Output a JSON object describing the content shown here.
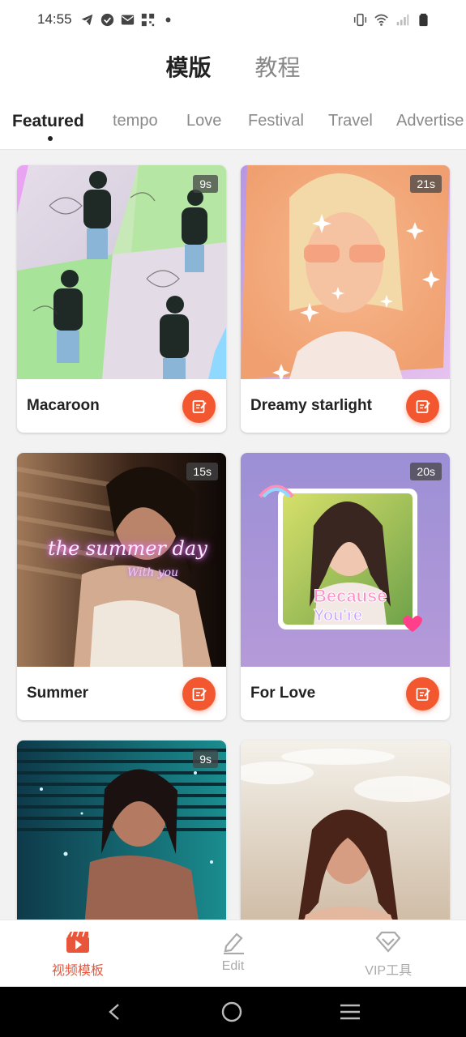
{
  "status_bar": {
    "time": "14:55",
    "left_icons": [
      "telegram-icon",
      "check-circle-icon",
      "mail-icon",
      "qr-icon",
      "dot-icon"
    ],
    "right_icons": [
      "vibrate-icon",
      "wifi-icon",
      "signal-icon",
      "battery-icon"
    ]
  },
  "top_tabs": [
    {
      "label": "模版",
      "active": true
    },
    {
      "label": "教程",
      "active": false
    }
  ],
  "category_tabs": [
    {
      "label": "Featured",
      "active": true
    },
    {
      "label": "tempo",
      "active": false
    },
    {
      "label": "Love",
      "active": false
    },
    {
      "label": "Festival",
      "active": false
    },
    {
      "label": "Travel",
      "active": false
    },
    {
      "label": "Advertise",
      "active": false
    }
  ],
  "cards": [
    {
      "title": "Macaroon",
      "duration": "9s"
    },
    {
      "title": "Dreamy starlight",
      "duration": "21s"
    },
    {
      "title": "Summer",
      "duration": "15s",
      "overlay_text": "the summer day",
      "overlay_sub": "With you"
    },
    {
      "title": "For Love",
      "duration": "20s",
      "overlay_text": "Because",
      "overlay_sub": "You're"
    },
    {
      "title": "",
      "duration": "9s"
    },
    {
      "title": "",
      "duration": ""
    }
  ],
  "bottom_nav": [
    {
      "label": "视频模板",
      "icon": "video-template-icon",
      "active": true
    },
    {
      "label": "Edit",
      "icon": "edit-pencil-icon",
      "active": false
    },
    {
      "label": "VIP工具",
      "icon": "vip-diamond-icon",
      "active": false
    }
  ],
  "colors": {
    "accent": "#f2572f",
    "nav_active": "#e8553a",
    "text_dark": "#222222",
    "text_muted": "#8a8a8a"
  }
}
